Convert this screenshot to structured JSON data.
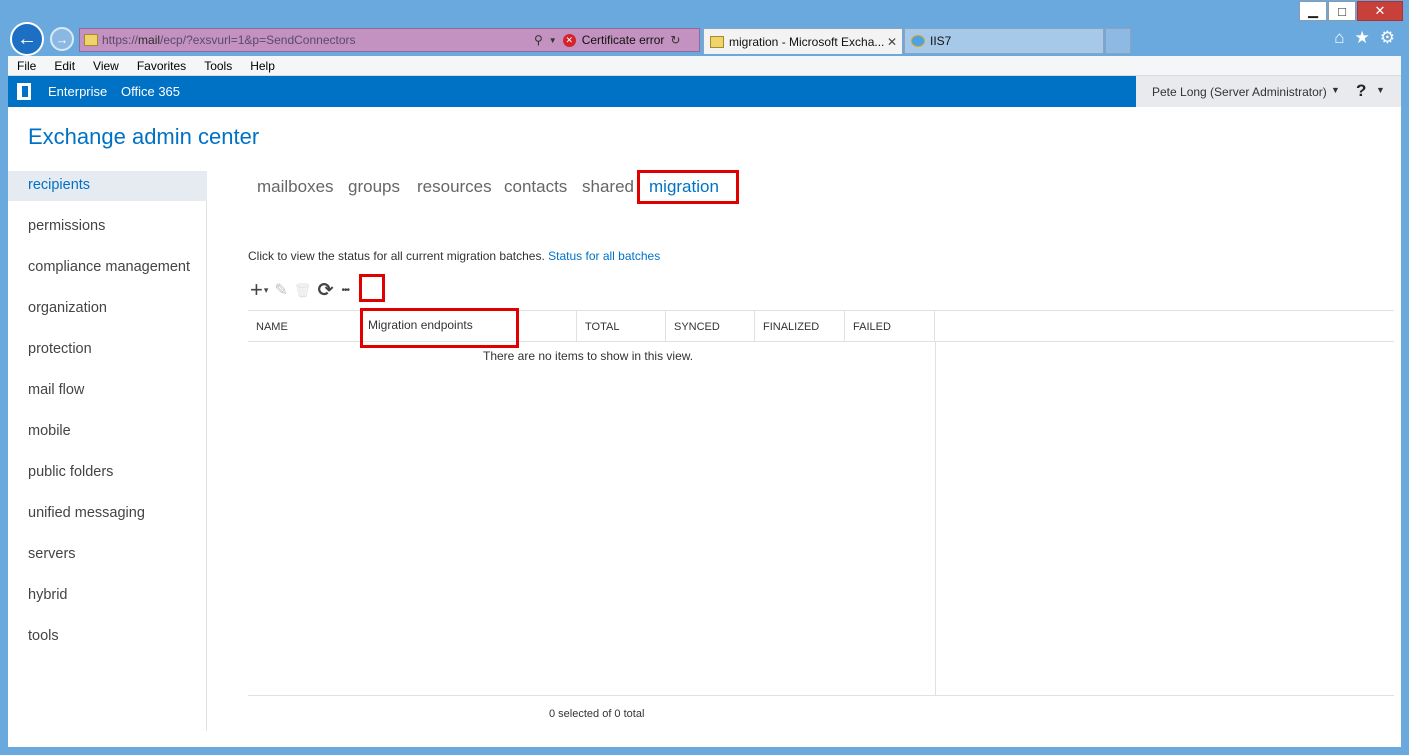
{
  "browser": {
    "url_prefix": "https://",
    "url_host": "mail",
    "url_rest": "/ecp/?exsvurl=1&p=SendConnectors",
    "cert_error": "Certificate error",
    "tabs": [
      {
        "label": "migration - Microsoft Excha...",
        "active": true
      },
      {
        "label": "IIS7",
        "active": false
      }
    ],
    "menu": [
      "File",
      "Edit",
      "View",
      "Favorites",
      "Tools",
      "Help"
    ],
    "window_controls": {
      "minimize": "▁",
      "maximize": "□",
      "close": "✕"
    }
  },
  "suitebar": {
    "enterprise": "Enterprise",
    "office365": "Office 365",
    "user": "Pete Long (Server Administrator)",
    "help": "?"
  },
  "app": {
    "title": "Exchange admin center"
  },
  "leftnav": {
    "items": [
      {
        "label": "recipients",
        "selected": true
      },
      {
        "label": "permissions"
      },
      {
        "label": "compliance management"
      },
      {
        "label": "organization"
      },
      {
        "label": "protection"
      },
      {
        "label": "mail flow"
      },
      {
        "label": "mobile"
      },
      {
        "label": "public folders"
      },
      {
        "label": "unified messaging"
      },
      {
        "label": "servers"
      },
      {
        "label": "hybrid"
      },
      {
        "label": "tools"
      }
    ]
  },
  "subtabs": [
    "mailboxes",
    "groups",
    "resources",
    "contacts",
    "shared",
    "migration"
  ],
  "active_subtab": "migration",
  "status": {
    "text": "Click to view the status for all current migration batches.",
    "link": "Status for all batches"
  },
  "toolbar": {
    "add": "+",
    "add_caret": "▾",
    "edit": "✎",
    "delete": "🗑",
    "refresh": "⟳",
    "more": "•••"
  },
  "grid": {
    "columns": [
      "NAME",
      "TOTAL",
      "SYNCED",
      "FINALIZED",
      "FAILED"
    ],
    "menu_item": "Migration endpoints",
    "empty": "There are no items to show in this view.",
    "footer": "0 selected of 0 total"
  },
  "colors": {
    "accent": "#0072c6",
    "highlight": "#e00000",
    "address_bar": "#c392c0"
  }
}
